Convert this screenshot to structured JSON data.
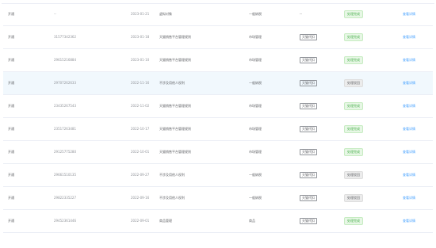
{
  "rows": [
    {
      "c1": "开通",
      "c2": "--",
      "c3": "2023-01-21",
      "c4": "虚拟对象",
      "c5": "一般纳税",
      "c6": "--",
      "c7": "处理完成",
      "status": "ok",
      "c8": "查看详情",
      "hl": false
    },
    {
      "c1": "开通",
      "c2": "31577342362",
      "c3": "2023-01-18",
      "c4": "天猫销售平台管理规则",
      "c5": "市场管理",
      "c6": "天猫代扣",
      "c7": "处理完成",
      "status": "ok",
      "c8": "查看详情",
      "hl": false
    },
    {
      "c1": "开通",
      "c2": "29615216884",
      "c3": "2023-01-10",
      "c4": "天猫销售平台管理规则",
      "c5": "市场管理",
      "c6": "天猫代扣",
      "c7": "处理完成",
      "status": "ok",
      "c8": "查看详情",
      "hl": false
    },
    {
      "c1": "开通",
      "c2": "29707262633",
      "c3": "2022-11-16",
      "c4": "不涉及用他人权利",
      "c5": "一般纳税",
      "c6": "天猫代扣",
      "c7": "处理驳回",
      "status": "bad",
      "c8": "查看详情",
      "hl": true
    },
    {
      "c1": "开通",
      "c2": "23435267543",
      "c3": "2022-11-02",
      "c4": "天猫销售平台管理规则",
      "c5": "市场管理",
      "c6": "天猫代扣",
      "c7": "处理完成",
      "status": "ok",
      "c8": "查看详情",
      "hl": false
    },
    {
      "c1": "开通",
      "c2": "23517263481",
      "c3": "2022-10-17",
      "c4": "天猫销售平台管理规则",
      "c5": "市场管理",
      "c6": "天猫代扣",
      "c7": "处理完成",
      "status": "ok",
      "c8": "查看详情",
      "hl": false
    },
    {
      "c1": "开通",
      "c2": "29125775280",
      "c3": "2022-10-01",
      "c4": "天猫销售平台管理规则",
      "c5": "市场管理",
      "c6": "天猫代扣",
      "c7": "处理完成",
      "status": "ok",
      "c8": "查看详情",
      "hl": false
    },
    {
      "c1": "开通",
      "c2": "29661510135",
      "c3": "2022-09-27",
      "c4": "不涉及用他人权利",
      "c5": "一般纳税",
      "c6": "天猫代扣",
      "c7": "处理驳回",
      "status": "bad",
      "c8": "查看详情",
      "hl": false
    },
    {
      "c1": "开通",
      "c2": "29822335227",
      "c3": "2022-09-16",
      "c4": "不涉及用他人权利",
      "c5": "一般纳税",
      "c6": "天猫代扣",
      "c7": "处理驳回",
      "status": "bad",
      "c8": "查看详情",
      "hl": false
    },
    {
      "c1": "开通",
      "c2": "29452361446",
      "c3": "2022-09-01",
      "c4": "商品管理",
      "c5": "商品",
      "c6": "天猫代扣",
      "c7": "处理完成",
      "status": "ok",
      "c8": "查看详情",
      "hl": false
    }
  ]
}
